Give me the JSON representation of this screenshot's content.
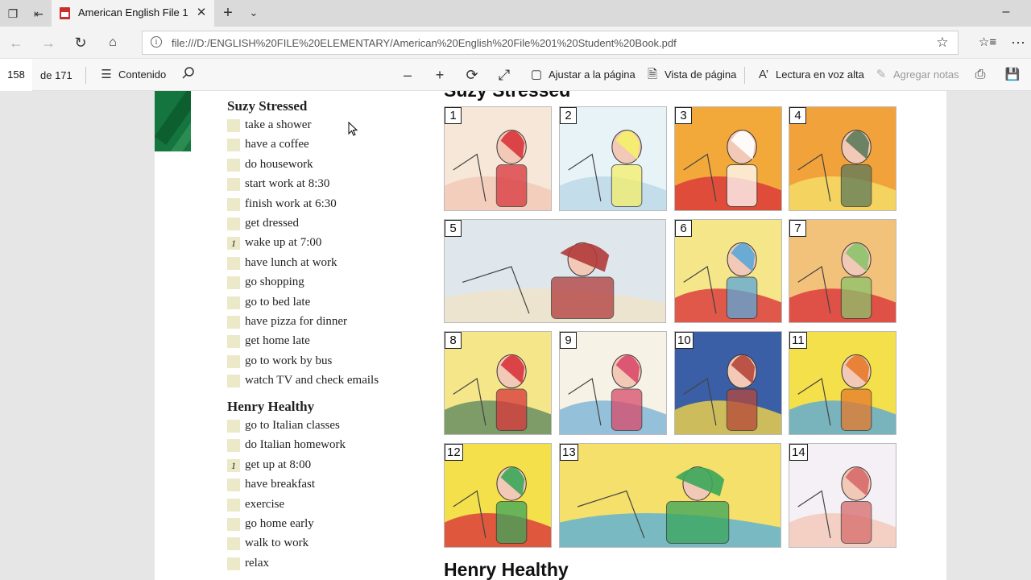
{
  "browser": {
    "tab_title": "American English File 1",
    "url": "file:///D:/ENGLISH%20FILE%20ELEMENTARY/American%20English%20File%201%20Student%20Book.pdf",
    "tab_icon": "pdf-icon"
  },
  "pdf_toolbar": {
    "page_number": "158",
    "page_total": "de 171",
    "contents_label": "Contenido",
    "fit_page_label": "Ajustar a la página",
    "page_view_label": "Vista de página",
    "read_aloud_label": "Lectura en voz alta",
    "add_notes_label": "Agregar notas"
  },
  "document": {
    "illustration_heading": "Suzy Stressed",
    "bottom_heading": "Henry Healthy",
    "suzy": {
      "title": "Suzy Stressed",
      "items": [
        {
          "mark": "",
          "text": "take a shower"
        },
        {
          "mark": "",
          "text": "have a coffee"
        },
        {
          "mark": "",
          "text": "do housework"
        },
        {
          "mark": "",
          "text": "start work at 8:30"
        },
        {
          "mark": "",
          "text": "finish work at 6:30"
        },
        {
          "mark": "",
          "text": "get dressed"
        },
        {
          "mark": "1",
          "text": "wake up at 7:00"
        },
        {
          "mark": "",
          "text": "have lunch at work"
        },
        {
          "mark": "",
          "text": "go shopping"
        },
        {
          "mark": "",
          "text": "go to bed late"
        },
        {
          "mark": "",
          "text": "have pizza for dinner"
        },
        {
          "mark": "",
          "text": "get home late"
        },
        {
          "mark": "",
          "text": "go to work by bus"
        },
        {
          "mark": "",
          "text": "watch TV and check emails"
        }
      ]
    },
    "henry": {
      "title": "Henry Healthy",
      "items": [
        {
          "mark": "",
          "text": "go to Italian classes"
        },
        {
          "mark": "",
          "text": "do Italian homework"
        },
        {
          "mark": "1",
          "text": "get up at 8:00"
        },
        {
          "mark": "",
          "text": "have breakfast"
        },
        {
          "mark": "",
          "text": "exercise"
        },
        {
          "mark": "",
          "text": "go home early"
        },
        {
          "mark": "",
          "text": "walk to work"
        },
        {
          "mark": "",
          "text": "relax"
        }
      ]
    },
    "panels": [
      "1",
      "2",
      "3",
      "4",
      "5",
      "6",
      "7",
      "8",
      "9",
      "10",
      "11",
      "12",
      "13",
      "14"
    ]
  },
  "colors": {
    "green_tab": "#14763e",
    "answer_box": "#ece9c8"
  }
}
